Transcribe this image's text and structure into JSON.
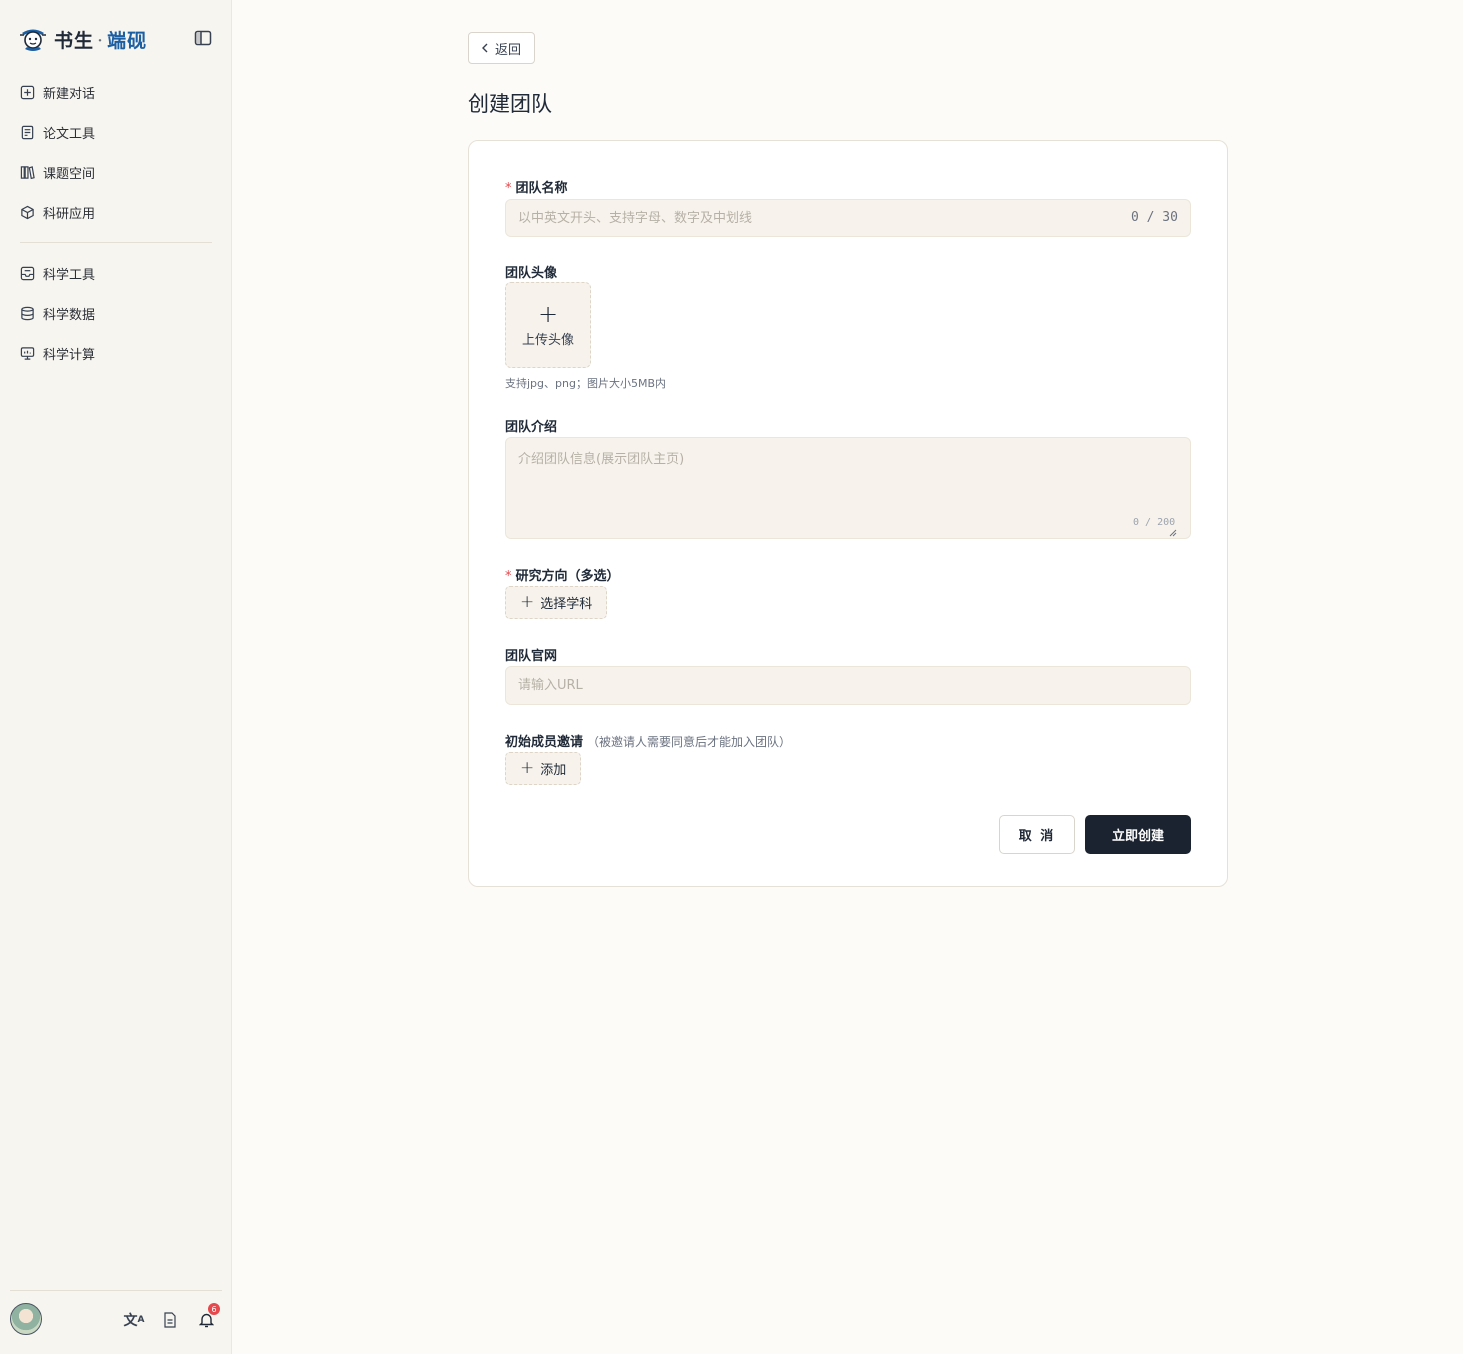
{
  "brand": {
    "name": "书生",
    "separator": "·",
    "product": "端砚"
  },
  "sidebar": {
    "items": [
      {
        "label": "新建对话",
        "icon": "plus-square-icon"
      },
      {
        "label": "论文工具",
        "icon": "document-icon"
      },
      {
        "label": "课题空间",
        "icon": "books-icon"
      },
      {
        "label": "科研应用",
        "icon": "cube-icon"
      },
      {
        "label": "科学工具",
        "icon": "tray-icon"
      },
      {
        "label": "科学数据",
        "icon": "database-icon"
      },
      {
        "label": "科学计算",
        "icon": "monitor-icon"
      }
    ],
    "footer": {
      "lang_glyph": "文",
      "lang_sup": "A",
      "notification_count": "6"
    }
  },
  "header": {
    "back_label": "返回",
    "title": "创建团队"
  },
  "form": {
    "team_name": {
      "label": "团队名称",
      "required": "*",
      "placeholder": "以中英文开头、支持字母、数字及中划线",
      "value": "",
      "counter": "0 / 30"
    },
    "avatar": {
      "label": "团队头像",
      "upload_plus": "+",
      "upload_text": "上传头像",
      "hint": "支持jpg、png；图片大小5MB内"
    },
    "intro": {
      "label": "团队介绍",
      "placeholder": "介绍团队信息(展示团队主页)",
      "value": "",
      "counter": "0 / 200"
    },
    "research": {
      "label": "研究方向（多选）",
      "required": "*",
      "button_plus": "+",
      "button_label": "选择学科"
    },
    "website": {
      "label": "团队官网",
      "placeholder": "请输入URL",
      "value": ""
    },
    "invite": {
      "label": "初始成员邀请",
      "note": "（被邀请人需要同意后才能加入团队）",
      "button_plus": "+",
      "button_label": "添加"
    },
    "cancel_label": "取 消",
    "submit_label": "立即创建"
  },
  "colors": {
    "accent": "#1b2330",
    "required": "#e5484d",
    "brand_blue": "#1d5fa3",
    "input_bg": "#f7f3ec"
  }
}
